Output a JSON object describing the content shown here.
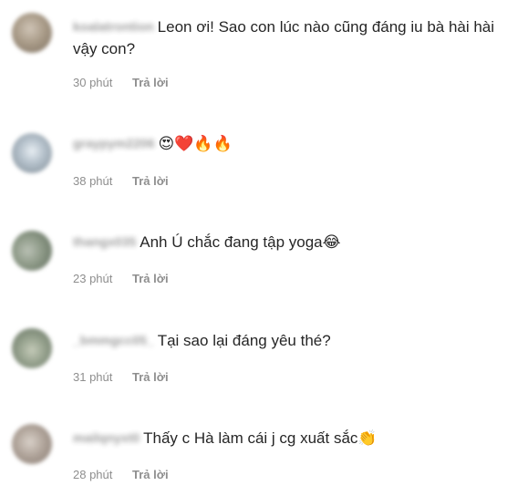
{
  "comments": [
    {
      "username": "koalatrontion",
      "text": "Leon ơi! Sao con lúc nào cũng đáng iu bà hài hài vậy con?",
      "emoji": "",
      "time": "30 phút",
      "reply": "Trả lời"
    },
    {
      "username": "graypym2206",
      "text": "",
      "emoji": "😍❤️🔥🔥",
      "time": "38 phút",
      "reply": "Trả lời"
    },
    {
      "username": "thangx035",
      "text": "Anh Ú chắc đang tập yoga",
      "emoji": "😂",
      "time": "23 phút",
      "reply": "Trả lời"
    },
    {
      "username": "_bmmgcc05_",
      "text": "Tại sao lại đáng yêu thé?",
      "emoji": "",
      "time": "31 phút",
      "reply": "Trả lời"
    },
    {
      "username": "mailqnyxt0",
      "text": "Thấy c Hà làm cái j cg xuất sắc",
      "emoji": "👏",
      "time": "28 phút",
      "reply": "Trả lời"
    }
  ]
}
